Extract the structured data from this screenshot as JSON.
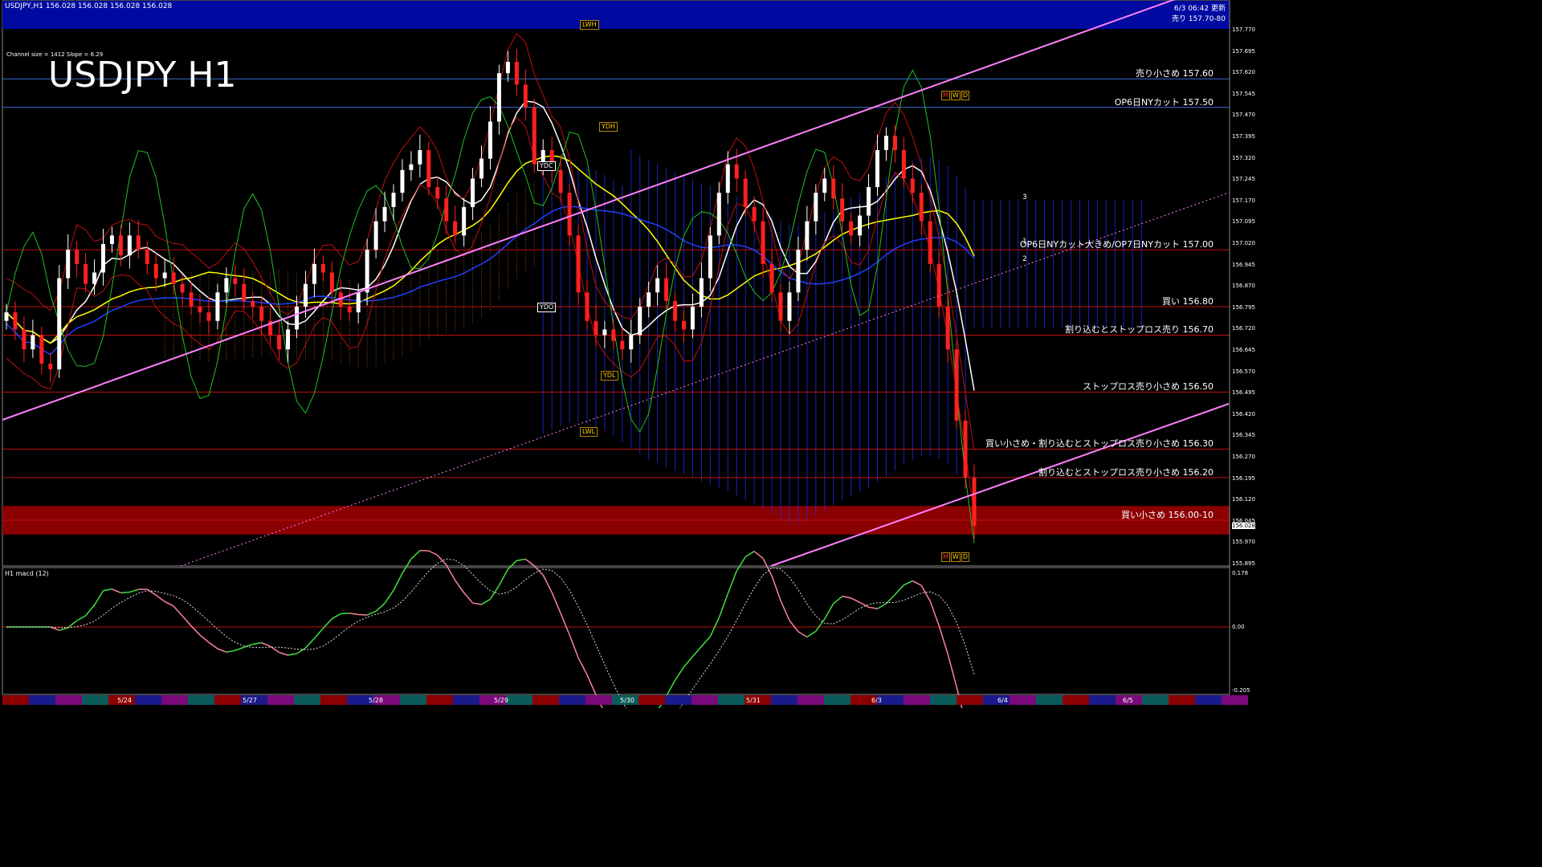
{
  "header": {
    "symbol_line": "USDJPY,H1  156.028 156.028 156.028 156.028",
    "channel": "Channel size = 1412 Slope = 6.29",
    "title": "USDJPY H1",
    "updated": "6/3 06:42 更新",
    "top_level": "売り 157.70-80"
  },
  "levels": [
    {
      "price": 157.6,
      "text": "売り小さめ 157.60",
      "color": "#3a6fd8"
    },
    {
      "price": 157.5,
      "text": "OP6日NYカット 157.50",
      "color": "#3a6fd8"
    },
    {
      "price": 157.0,
      "text": "OP6日NYカット大きめ/OP7日NYカット 157.00",
      "color": "#c01010"
    },
    {
      "price": 156.8,
      "text": "買い 156.80",
      "color": "#c01010"
    },
    {
      "price": 156.7,
      "text": "割り込むとストップロス売り 156.70",
      "color": "#c01010"
    },
    {
      "price": 156.5,
      "text": "ストップロス売り小さめ 156.50",
      "color": "#c01010"
    },
    {
      "price": 156.3,
      "text": "買い小さめ・割り込むとストップロス売り小さめ 156.30",
      "color": "#c01010"
    },
    {
      "price": 156.2,
      "text": "割り込むとストップロス売り小さめ 156.20",
      "color": "#c01010"
    },
    {
      "price": 156.05,
      "text": "買い小さめ 156.00-10",
      "color": "#c01010"
    }
  ],
  "price_axis": [
    "157.770",
    "157.695",
    "157.620",
    "157.545",
    "157.470",
    "157.395",
    "157.320",
    "157.245",
    "157.170",
    "157.095",
    "157.020",
    "156.945",
    "156.870",
    "156.795",
    "156.720",
    "156.645",
    "156.570",
    "156.495",
    "156.420",
    "156.345",
    "156.270",
    "156.195",
    "156.120",
    "156.045",
    "155.970",
    "155.895"
  ],
  "current_price": "156.028",
  "markers": {
    "lwh": "LWH",
    "ydh": "YDH",
    "ydc": "YDC",
    "ydo": "YDO",
    "ydl": "YDL",
    "lwl": "LWL",
    "m": "M",
    "w": "W",
    "d": "D",
    "n1": "1",
    "n2": "2",
    "n3": "3"
  },
  "subwindow": {
    "label": "H1  macd (12)",
    "axis": [
      "0.178",
      "0.00",
      "-0.205"
    ]
  },
  "date_labels": [
    "5/24",
    "5/27",
    "5/28",
    "5/29",
    "5/30",
    "5/31",
    "6/3",
    "6/4",
    "6/5"
  ],
  "chart_data": {
    "type": "candlestick",
    "symbol": "USDJPY",
    "timeframe": "H1",
    "ylim": [
      155.895,
      157.77
    ],
    "close_path": [
      156.78,
      156.72,
      156.65,
      156.7,
      156.6,
      156.58,
      156.9,
      157.0,
      156.95,
      156.88,
      156.92,
      157.02,
      157.05,
      156.98,
      157.05,
      157.0,
      156.95,
      156.9,
      156.92,
      156.88,
      156.85,
      156.8,
      156.78,
      156.75,
      156.85,
      156.9,
      156.88,
      156.82,
      156.8,
      156.75,
      156.7,
      156.65,
      156.72,
      156.8,
      156.88,
      156.95,
      156.92,
      156.85,
      156.8,
      156.78,
      156.85,
      157.0,
      157.1,
      157.15,
      157.2,
      157.28,
      157.3,
      157.35,
      157.22,
      157.18,
      157.1,
      157.05,
      157.15,
      157.25,
      157.32,
      157.45,
      157.62,
      157.66,
      157.58,
      157.5,
      157.3,
      157.35,
      157.28,
      157.2,
      157.05,
      156.85,
      156.75,
      156.7,
      156.72,
      156.68,
      156.65,
      156.7,
      156.8,
      156.85,
      156.9,
      156.82,
      156.75,
      156.72,
      156.8,
      156.9,
      157.05,
      157.2,
      157.3,
      157.25,
      157.15,
      157.1,
      156.95,
      156.85,
      156.75,
      156.85,
      157.0,
      157.1,
      157.2,
      157.25,
      157.18,
      157.1,
      157.05,
      157.12,
      157.22,
      157.35,
      157.4,
      157.35,
      157.25,
      157.2,
      157.1,
      156.95,
      156.8,
      156.65,
      156.4,
      156.2,
      156.03
    ],
    "ichimoku_cloud": "shown",
    "moving_averages": [
      "white",
      "yellow",
      "blue"
    ],
    "macd_series": [
      {
        "name": "macd (12)"
      }
    ],
    "x": [
      "5/24",
      "5/27",
      "5/28",
      "5/29",
      "5/30",
      "5/31",
      "6/3",
      "6/4",
      "6/5"
    ]
  }
}
